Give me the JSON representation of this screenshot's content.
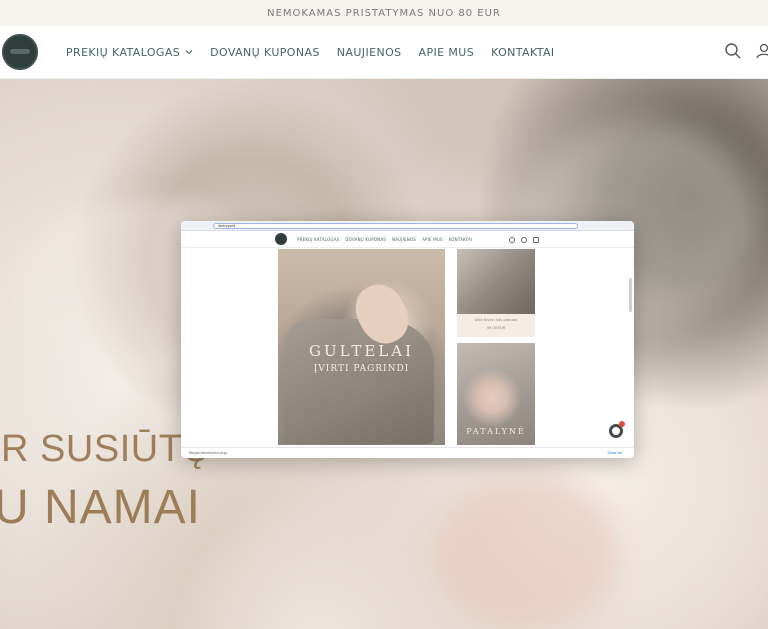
{
  "announcement": "NEMOKAMAS PRISTATYMAS NUO 80 EUR",
  "nav": {
    "items": [
      "PREKIŲ KATALOGAS",
      "DOVANŲ KUPONAS",
      "NAUJIENOS",
      "APIE MUS",
      "KONTAKTAI"
    ]
  },
  "hero": {
    "line1": "IR SUSIŪTŲ",
    "line2": "U NAMAI"
  },
  "inset": {
    "url": "ibebypaid",
    "mini_nav": [
      "PREKIŲ KATALOGAS",
      "DOVANŲ KUPONAS",
      "NAUJIENOS",
      "APIE MUS",
      "KONTAKTAI"
    ],
    "panel_main_title": "GULTELAI",
    "panel_main_subtitle": "ĮVIRTI PAGRINDI",
    "product_name": "Ghlė ševrin fotu pleruzai",
    "product_price": "49,00 EUR",
    "panel_bottom_title": "PATALYNĖ",
    "download_file": "Skype-emoticons.png",
    "download_show": "Show all"
  },
  "colors": {
    "accent": "#9e7f59",
    "nav_text": "#476464",
    "announce_bg": "#f7f3ef"
  }
}
